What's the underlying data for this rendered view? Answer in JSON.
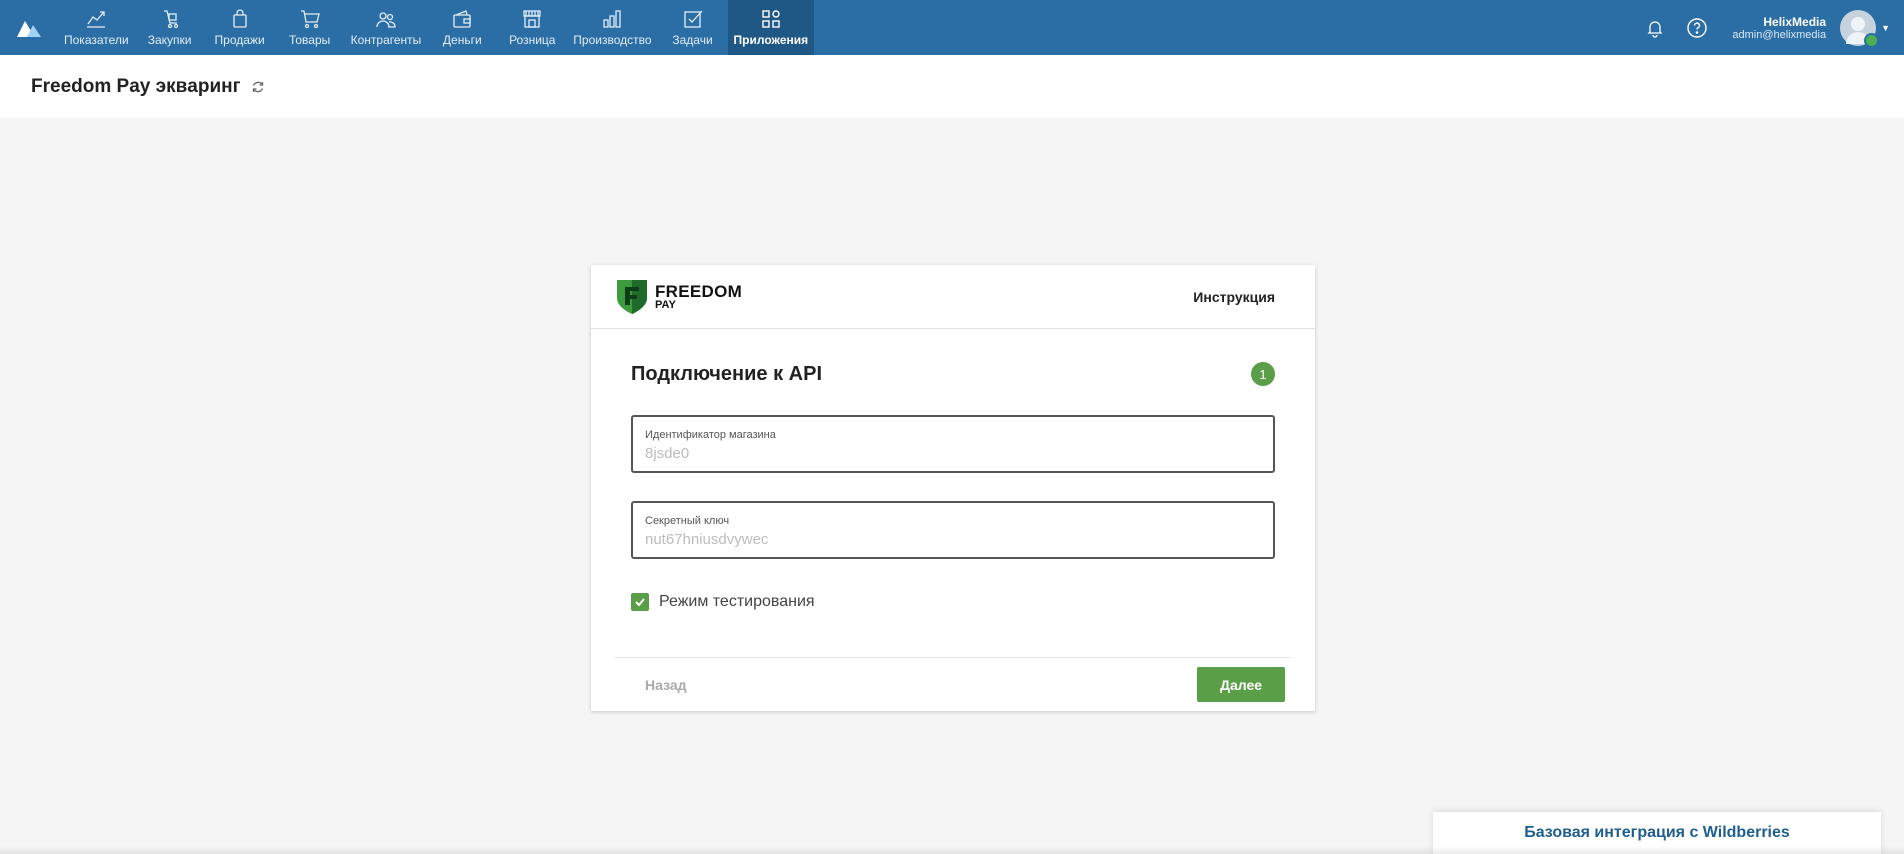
{
  "nav": {
    "items": [
      {
        "label": "Показатели",
        "icon": "chart-line-icon"
      },
      {
        "label": "Закупки",
        "icon": "cart-hand-icon"
      },
      {
        "label": "Продажи",
        "icon": "bag-icon"
      },
      {
        "label": "Товары",
        "icon": "cart-icon"
      },
      {
        "label": "Контрагенты",
        "icon": "people-icon"
      },
      {
        "label": "Деньги",
        "icon": "wallet-icon"
      },
      {
        "label": "Розница",
        "icon": "store-icon"
      },
      {
        "label": "Производство",
        "icon": "bars-icon"
      },
      {
        "label": "Задачи",
        "icon": "task-check-icon"
      },
      {
        "label": "Приложения",
        "icon": "apps-icon",
        "active": true
      }
    ]
  },
  "user": {
    "name": "HelixMedia",
    "email": "admin@helixmedia"
  },
  "page": {
    "title": "Freedom Pay эквaринг"
  },
  "card": {
    "brand_line1": "FREEDOM",
    "brand_line2": "PAY",
    "instructions_link": "Инструкция",
    "section_title": "Подключение к API",
    "step_number": "1",
    "fields": [
      {
        "label": "Идентификатор магазина",
        "value": "8jsde0"
      },
      {
        "label": "Секретный ключ",
        "value": "nut67hniusdvywec"
      }
    ],
    "test_mode_label": "Режим тестирования",
    "test_mode_checked": true,
    "back_label": "Назад",
    "next_label": "Далее"
  },
  "promo": {
    "text": "Базовая интеграция с Wildberries"
  },
  "colors": {
    "topbar": "#2a6ea5",
    "active_nav": "#1f5885",
    "accent_green": "#5a9e47",
    "promo_text": "#1f5f8f"
  }
}
